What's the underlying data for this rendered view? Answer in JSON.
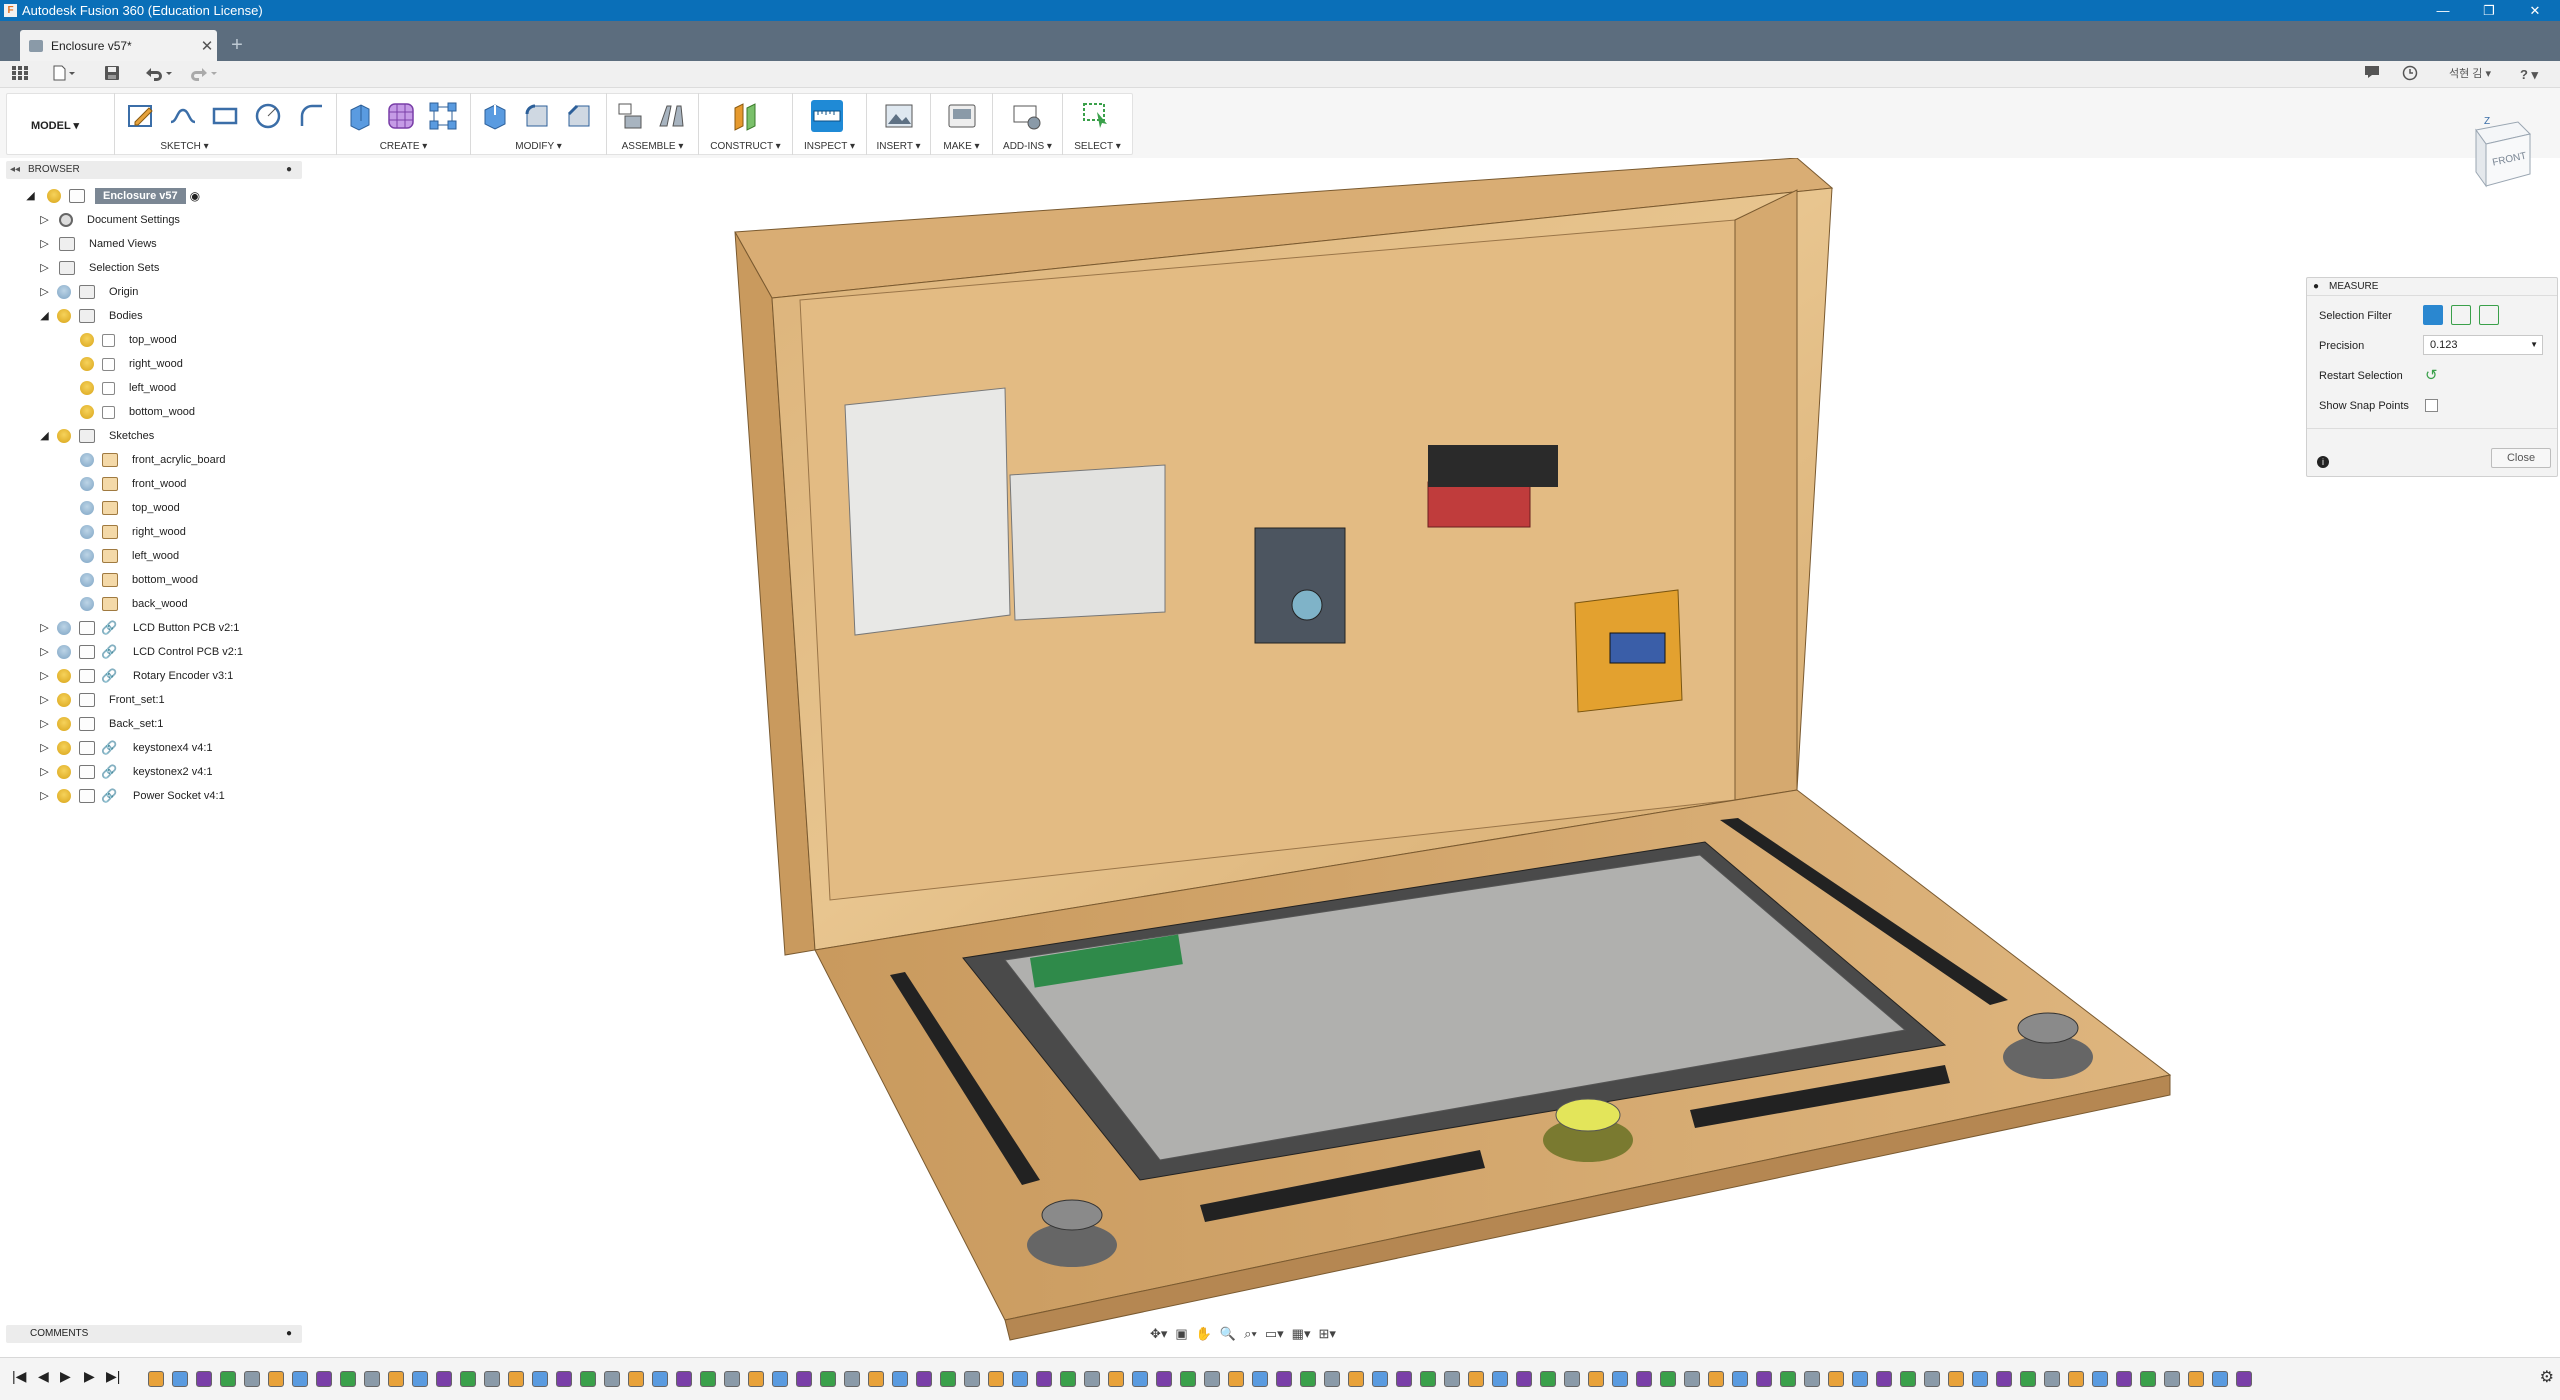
{
  "window": {
    "title": "Autodesk Fusion 360 (Education License)",
    "minimize": "—",
    "restore": "❐",
    "close": "✕"
  },
  "tab": {
    "label": "Enclosure v57*",
    "close": "✕",
    "new_tab": "+"
  },
  "quick_access": {
    "data_panel_icon": "grid-icon",
    "file_icon": "file-icon",
    "save_icon": "save-icon",
    "undo_icon": "undo-icon",
    "redo_icon": "redo-icon",
    "user_name": "석현 김",
    "help": "?"
  },
  "ribbon": {
    "workspace": "MODEL ▾",
    "groups": [
      {
        "label": "SKETCH ▾"
      },
      {
        "label": "CREATE ▾"
      },
      {
        "label": "MODIFY ▾"
      },
      {
        "label": "ASSEMBLE ▾"
      },
      {
        "label": "CONSTRUCT ▾"
      },
      {
        "label": "INSPECT ▾"
      },
      {
        "label": "INSERT ▾"
      },
      {
        "label": "MAKE ▾"
      },
      {
        "label": "ADD-INS ▾"
      },
      {
        "label": "SELECT ▾"
      }
    ]
  },
  "browser": {
    "title": "BROWSER",
    "root": "Enclosure v57",
    "items": [
      {
        "label": "Document Settings"
      },
      {
        "label": "Named Views"
      },
      {
        "label": "Selection Sets"
      },
      {
        "label": "Origin"
      },
      {
        "label": "Bodies"
      },
      {
        "label": "top_wood"
      },
      {
        "label": "right_wood"
      },
      {
        "label": "left_wood"
      },
      {
        "label": "bottom_wood"
      },
      {
        "label": "Sketches"
      },
      {
        "label": "front_acrylic_board"
      },
      {
        "label": "front_wood"
      },
      {
        "label": "top_wood"
      },
      {
        "label": "right_wood"
      },
      {
        "label": "left_wood"
      },
      {
        "label": "bottom_wood"
      },
      {
        "label": "back_wood"
      },
      {
        "label": "LCD Button PCB v2:1"
      },
      {
        "label": "LCD Control PCB v2:1"
      },
      {
        "label": "Rotary Encoder v3:1"
      },
      {
        "label": "Front_set:1"
      },
      {
        "label": "Back_set:1"
      },
      {
        "label": "keystonex4 v4:1"
      },
      {
        "label": "keystonex2 v4:1"
      },
      {
        "label": "Power Socket v4:1"
      }
    ]
  },
  "comments": {
    "title": "COMMENTS"
  },
  "measure": {
    "title": "MEASURE",
    "selection_filter_label": "Selection Filter",
    "precision_label": "Precision",
    "precision_value": "0.123",
    "restart_label": "Restart Selection",
    "snap_label": "Show Snap Points",
    "close_label": "Close"
  },
  "viewcube": {
    "face": "FRONT"
  },
  "timeline": {
    "first": "|◀",
    "prev": "◀",
    "play": "▶",
    "next": "▶",
    "last": "▶|"
  }
}
